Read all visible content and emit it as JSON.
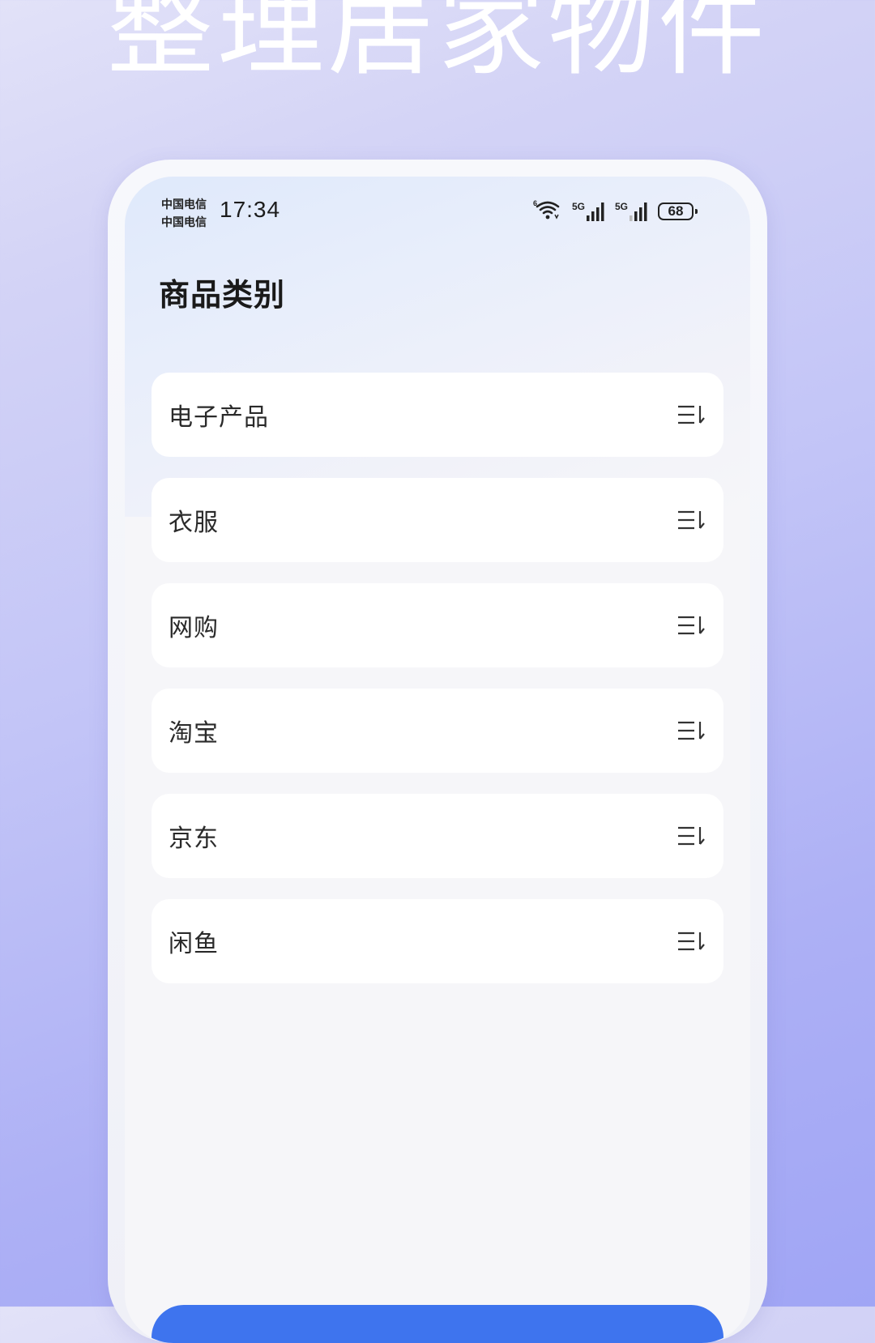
{
  "headline": "整理居家物件",
  "status_bar": {
    "carrier_1": "中国电信",
    "carrier_2": "中国电信",
    "time": "17:34",
    "network_1": "5G",
    "network_2": "5G",
    "battery": "68",
    "icons": [
      "wifi-icon",
      "signal-icon",
      "signal-icon",
      "battery-icon"
    ]
  },
  "page": {
    "title": "商品类别"
  },
  "categories": [
    {
      "label": "电子产品",
      "icon": "sort-icon"
    },
    {
      "label": "衣服",
      "icon": "sort-icon"
    },
    {
      "label": "网购",
      "icon": "sort-icon"
    },
    {
      "label": "淘宝",
      "icon": "sort-icon"
    },
    {
      "label": "京东",
      "icon": "sort-icon"
    },
    {
      "label": "闲鱼",
      "icon": "sort-icon"
    }
  ],
  "colors": {
    "accent": "#3e74ee",
    "card": "#ffffff",
    "screen_bg": "#f6f6f9"
  }
}
